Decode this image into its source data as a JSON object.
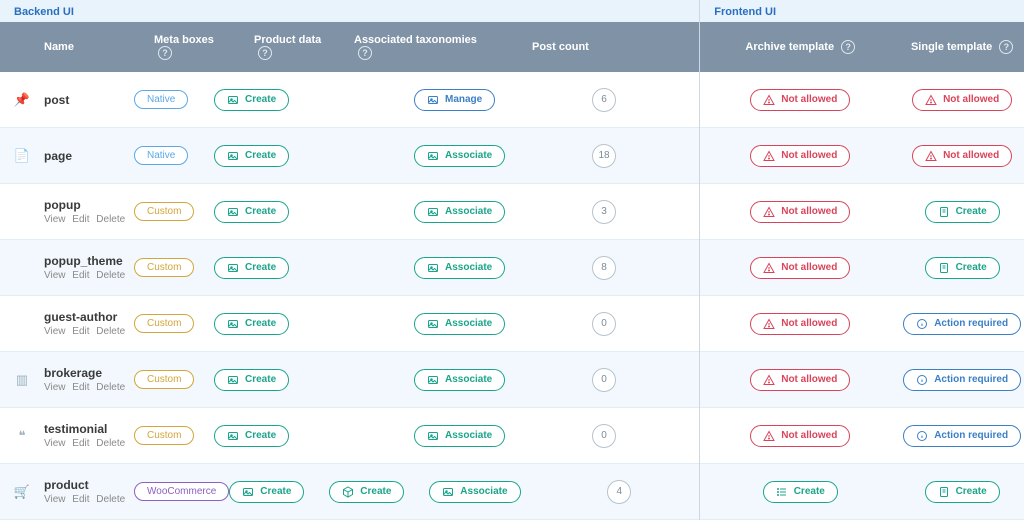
{
  "sections": {
    "backend": "Backend UI",
    "frontend": "Frontend UI"
  },
  "headers": {
    "name": "Name",
    "meta": "Meta boxes",
    "pdata": "Product data",
    "tax": "Associated taxonomies",
    "count": "Post count",
    "archive": "Archive template",
    "single": "Single template"
  },
  "labels": {
    "native": "Native",
    "custom": "Custom",
    "woo": "WooCommerce",
    "create": "Create",
    "manage": "Manage",
    "associate": "Associate",
    "not_allowed": "Not allowed",
    "action_required": "Action required",
    "view": "View",
    "edit": "Edit",
    "delete": "Delete"
  },
  "rows": [
    {
      "icon": "pin",
      "name": "post",
      "sub": false,
      "badge": "native",
      "tax": "manage",
      "count": "6",
      "archive": "not_allowed",
      "single": "not_allowed"
    },
    {
      "icon": "page",
      "name": "page",
      "sub": false,
      "badge": "native",
      "tax": "associate",
      "count": "18",
      "archive": "not_allowed",
      "single": "not_allowed"
    },
    {
      "icon": "",
      "name": "popup",
      "sub": true,
      "badge": "custom",
      "tax": "associate",
      "count": "3",
      "archive": "not_allowed",
      "single": "create"
    },
    {
      "icon": "",
      "name": "popup_theme",
      "sub": true,
      "badge": "custom",
      "tax": "associate",
      "count": "8",
      "archive": "not_allowed",
      "single": "create"
    },
    {
      "icon": "",
      "name": "guest-author",
      "sub": true,
      "badge": "custom",
      "tax": "associate",
      "count": "0",
      "archive": "not_allowed",
      "single": "action"
    },
    {
      "icon": "bars",
      "name": "brokerage",
      "sub": true,
      "badge": "custom",
      "tax": "associate",
      "count": "0",
      "archive": "not_allowed",
      "single": "action"
    },
    {
      "icon": "quote",
      "name": "testimonial",
      "sub": true,
      "badge": "custom",
      "tax": "associate",
      "count": "0",
      "archive": "not_allowed",
      "single": "action"
    },
    {
      "icon": "cart",
      "name": "product",
      "sub": true,
      "badge": "woo",
      "tax": "associate",
      "count": "4",
      "archive": "create",
      "single": "create",
      "pdata": "create"
    }
  ]
}
